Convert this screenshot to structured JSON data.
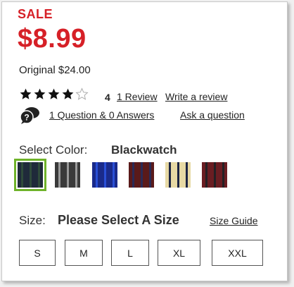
{
  "sale_label": "SALE",
  "sale_price": "$8.99",
  "original_price": "Original $24.00",
  "rating": {
    "value": 4,
    "max": 5,
    "value_label": "4",
    "review_link": "1 Review",
    "write_review": "Write a review"
  },
  "qa": {
    "icon": "question-chat-icon",
    "summary_link": "1 Question & 0 Answers",
    "ask_link": "Ask a question"
  },
  "color": {
    "label": "Select Color:",
    "selected": "Blackwatch",
    "swatches": [
      {
        "name": "blackwatch",
        "colors": [
          "#1f2a3a",
          "#2e4a3a"
        ]
      },
      {
        "name": "gray-black",
        "colors": [
          "#3a3a3a",
          "#9a9a9a"
        ]
      },
      {
        "name": "blue-black",
        "colors": [
          "#1a2a8a",
          "#2a4fd6"
        ]
      },
      {
        "name": "red-navy",
        "colors": [
          "#5a1a1a",
          "#2a2a55"
        ]
      },
      {
        "name": "cream-navy",
        "colors": [
          "#e7d9a4",
          "#1c2442"
        ]
      },
      {
        "name": "red-black",
        "colors": [
          "#6a1d22",
          "#242024"
        ]
      }
    ]
  },
  "size": {
    "label": "Size:",
    "prompt": "Please Select A Size",
    "guide_link": "Size Guide",
    "options": [
      "S",
      "M",
      "L",
      "XL",
      "XXL"
    ]
  },
  "colors": {
    "sale_red": "#d62027",
    "star_fill": "#111111",
    "selected_outline": "#6fb32a"
  }
}
